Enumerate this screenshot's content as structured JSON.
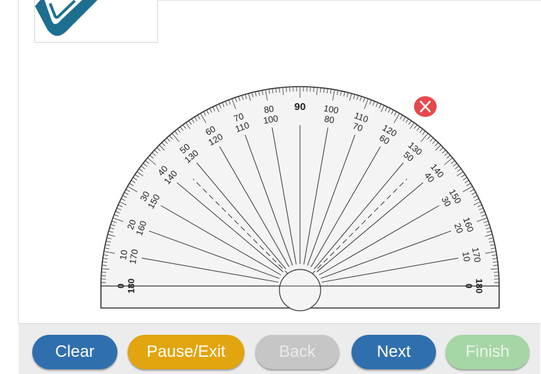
{
  "footer": {
    "clear_label": "Clear",
    "pause_label": "Pause/Exit",
    "back_label": "Back",
    "next_label": "Next",
    "finish_label": "Finish",
    "back_enabled": false,
    "finish_enabled": false
  },
  "protractor": {
    "outer_scale_labels": [
      "0",
      "10",
      "20",
      "30",
      "40",
      "50",
      "60",
      "70",
      "80",
      "90",
      "100",
      "110",
      "120",
      "130",
      "140",
      "150",
      "160",
      "170",
      "180"
    ],
    "inner_scale_labels": [
      "180",
      "170",
      "160",
      "150",
      "140",
      "130",
      "120",
      "110",
      "100",
      "80",
      "70",
      "60",
      "50",
      "40",
      "30",
      "20",
      "10",
      "0"
    ],
    "dashed_ray_angles": [
      45,
      135
    ]
  },
  "icons": {
    "logo": "checkmark-logo-icon",
    "close": "close-icon"
  },
  "colors": {
    "clear": "#2f6fad",
    "pause": "#e2a50f",
    "back_disabled": "#c6c6c6",
    "next": "#2f6fad",
    "finish_disabled": "#a6d6a6",
    "close": "#e5484d",
    "logo": "#1d6f8f"
  }
}
